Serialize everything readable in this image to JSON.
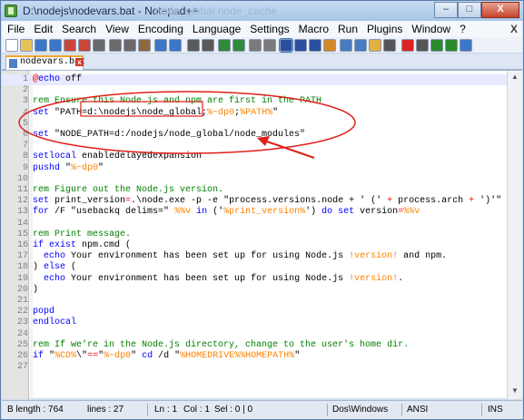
{
  "window": {
    "title": "D:\\nodejs\\nodevars.bat - Notepad++",
    "title_ghost": "node_global  node_cache",
    "buttons": {
      "minimize": "–",
      "maximize": "□",
      "close": "X"
    }
  },
  "menu": {
    "items": [
      "File",
      "Edit",
      "Search",
      "View",
      "Encoding",
      "Language",
      "Settings",
      "Macro",
      "Run",
      "Plugins",
      "Window",
      "?"
    ],
    "close_doc": "X"
  },
  "toolbar": {
    "icons": [
      "new-file-icon",
      "open-file-icon",
      "save-icon",
      "save-all-icon",
      "close-icon",
      "close-all-icon",
      "print-icon",
      "cut-icon",
      "copy-icon",
      "paste-icon",
      "undo-icon",
      "redo-icon",
      "find-icon",
      "replace-icon",
      "zoom-in-icon",
      "zoom-out-icon",
      "sync-scroll-v-icon",
      "sync-scroll-h-icon",
      "word-wrap-icon",
      "all-chars-icon",
      "indent-guide-icon",
      "user-lang-icon",
      "doc-map-icon",
      "function-list-icon",
      "folder-workspace-icon",
      "monitor-icon",
      "record-macro-icon",
      "stop-record-icon",
      "play-macro-icon",
      "run-macro-multiple-icon",
      "save-macro-icon"
    ]
  },
  "tab": {
    "label": "nodevars.bat",
    "close": "x"
  },
  "editor": {
    "lines": [
      {
        "n": "1",
        "parts": [
          [
            "at",
            "@"
          ],
          [
            "word",
            "echo"
          ],
          [
            "plain",
            " off"
          ]
        ]
      },
      {
        "n": "2",
        "parts": []
      },
      {
        "n": "3",
        "parts": [
          [
            "rem",
            "rem Ensure this Node.js and npm are first in the PATH"
          ]
        ]
      },
      {
        "n": "4",
        "parts": [
          [
            "word",
            "set"
          ],
          [
            "plain",
            " \"PATH=d:\\nodejs\\node_global;"
          ],
          [
            "var",
            "%~dp0"
          ],
          [
            "plain",
            ";"
          ],
          [
            "var",
            "%PATH%"
          ],
          [
            "plain",
            "\""
          ]
        ]
      },
      {
        "n": "5",
        "parts": []
      },
      {
        "n": "6",
        "parts": [
          [
            "word",
            "set"
          ],
          [
            "plain",
            " \"NODE_PATH=d:/nodejs/node_global/node_modules\""
          ]
        ]
      },
      {
        "n": "7",
        "parts": []
      },
      {
        "n": "8",
        "parts": [
          [
            "word",
            "setlocal"
          ],
          [
            "plain",
            " enabledelayedexpansion"
          ]
        ]
      },
      {
        "n": "9",
        "parts": [
          [
            "word",
            "pushd"
          ],
          [
            "plain",
            " \""
          ],
          [
            "var",
            "%~dp0"
          ],
          [
            "plain",
            "\""
          ]
        ]
      },
      {
        "n": "10",
        "parts": []
      },
      {
        "n": "11",
        "parts": [
          [
            "rem",
            "rem Figure out the Node.js version."
          ]
        ]
      },
      {
        "n": "12",
        "parts": [
          [
            "word",
            "set"
          ],
          [
            "plain",
            " print_version"
          ],
          [
            "op",
            "="
          ],
          [
            "plain",
            ".\\node.exe -p -e \"process.versions.node + ' (' "
          ],
          [
            "op",
            "+"
          ],
          [
            "plain",
            " process.arch "
          ],
          [
            "op",
            "+"
          ],
          [
            "plain",
            " ')'\""
          ]
        ]
      },
      {
        "n": "13",
        "parts": [
          [
            "word",
            "for"
          ],
          [
            "plain",
            " /F \"usebackq delims="
          ],
          [
            "plain",
            "\" "
          ],
          [
            "var",
            "%%v"
          ],
          [
            "word",
            " in"
          ],
          [
            "plain",
            " ('"
          ],
          [
            "var",
            "%print_version%"
          ],
          [
            "plain",
            "') "
          ],
          [
            "word",
            "do"
          ],
          [
            "word",
            " set"
          ],
          [
            "plain",
            " version"
          ],
          [
            "op",
            "="
          ],
          [
            "var",
            "%%v"
          ]
        ]
      },
      {
        "n": "14",
        "parts": []
      },
      {
        "n": "15",
        "parts": [
          [
            "rem",
            "rem Print message."
          ]
        ]
      },
      {
        "n": "16",
        "parts": [
          [
            "word",
            "if exist"
          ],
          [
            "plain",
            " npm.cmd ("
          ]
        ]
      },
      {
        "n": "17",
        "parts": [
          [
            "plain",
            "  "
          ],
          [
            "word",
            "echo"
          ],
          [
            "plain",
            " Your environment has been set up for using Node.js "
          ],
          [
            "var",
            "!version!"
          ],
          [
            "plain",
            " and npm."
          ]
        ]
      },
      {
        "n": "18",
        "parts": [
          [
            "plain",
            ") "
          ],
          [
            "word",
            "else"
          ],
          [
            "plain",
            " ("
          ]
        ]
      },
      {
        "n": "19",
        "parts": [
          [
            "plain",
            "  "
          ],
          [
            "word",
            "echo"
          ],
          [
            "plain",
            " Your environment has been set up for using Node.js "
          ],
          [
            "var",
            "!version!"
          ],
          [
            "plain",
            "."
          ]
        ]
      },
      {
        "n": "20",
        "parts": [
          [
            "plain",
            ")"
          ]
        ]
      },
      {
        "n": "21",
        "parts": []
      },
      {
        "n": "22",
        "parts": [
          [
            "word",
            "popd"
          ]
        ]
      },
      {
        "n": "23",
        "parts": [
          [
            "word",
            "endlocal"
          ]
        ]
      },
      {
        "n": "24",
        "parts": []
      },
      {
        "n": "25",
        "parts": [
          [
            "rem",
            "rem If we're in the Node.js directory, change to the user's home dir."
          ]
        ]
      },
      {
        "n": "26",
        "parts": [
          [
            "word",
            "if"
          ],
          [
            "plain",
            " \""
          ],
          [
            "var",
            "%CD%"
          ],
          [
            "plain",
            "\\\""
          ],
          [
            "op",
            "=="
          ],
          [
            "plain",
            "\""
          ],
          [
            "var",
            "%~dp0"
          ],
          [
            "plain",
            "\" "
          ],
          [
            "word",
            "cd"
          ],
          [
            "plain",
            " /d \""
          ],
          [
            "var",
            "%HOMEDRIVE%%HOMEPATH%"
          ],
          [
            "plain",
            "\""
          ]
        ]
      },
      {
        "n": "27",
        "parts": []
      }
    ]
  },
  "status": {
    "length": "B length : 764",
    "lines": "lines : 27",
    "ln": "Ln : 1",
    "col": "Col : 1",
    "sel": "Sel : 0 | 0",
    "eol": "Dos\\Windows",
    "encoding": "ANSI",
    "mode": "INS"
  },
  "colors": {
    "keyword": "#0000ff",
    "string": "#808080",
    "variable": "#ff8000",
    "comment": "#008000",
    "annotation": "#e0201a"
  }
}
